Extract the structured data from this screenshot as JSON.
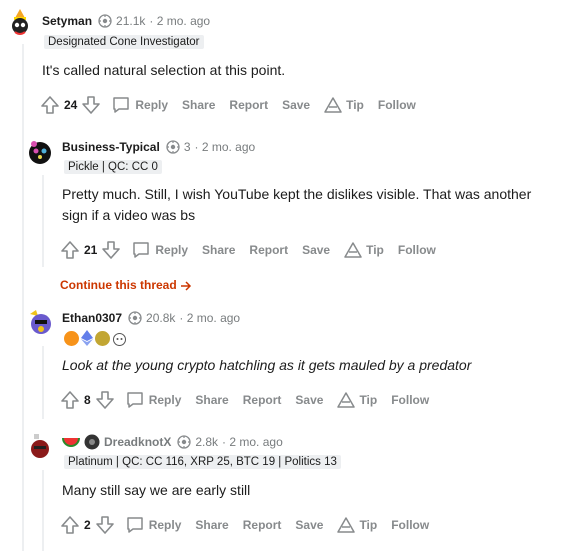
{
  "comments": [
    {
      "username": "Setyman",
      "karma": "21.1k",
      "age": "· 2 mo. ago",
      "flair": "Designated Cone Investigator",
      "body": "It's called natural selection at this point.",
      "votes": "24"
    },
    {
      "username": "Business-Typical",
      "karma": "3",
      "age": "· 2 mo. ago",
      "flair": "Pickle | QC: CC 0",
      "body_line1": "Pretty much. Still, I wish YouTube kept the dislikes visible. That was another",
      "body_line2": "sign if a video was bs",
      "votes": "21"
    },
    {
      "username": "Ethan0307",
      "karma": "20.8k",
      "age": "· 2 mo. ago",
      "body": "Look at the young crypto hatchling as it gets mauled by a predator",
      "votes": "8"
    },
    {
      "username": "DreadknotX",
      "karma": "2.8k",
      "age": "· 2 mo. ago",
      "flair": "Platinum | QC: CC 116, XRP 25, BTC 19 | Politics 13",
      "body": "Many still say we are early still",
      "votes": "2"
    }
  ],
  "actions": {
    "reply": "Reply",
    "share": "Share",
    "report": "Report",
    "save": "Save",
    "tip": "Tip",
    "follow": "Follow"
  },
  "continue_thread": "Continue this thread",
  "colors": {
    "accent_link": "#cc3700",
    "action_grey": "#878a8c",
    "flair_bg": "#edeff1",
    "thread_line": "#edeff1"
  },
  "icons": [
    "upvote-icon",
    "downvote-icon",
    "comment-icon",
    "tip-icon",
    "karma-icon",
    "arrow-right-icon"
  ]
}
